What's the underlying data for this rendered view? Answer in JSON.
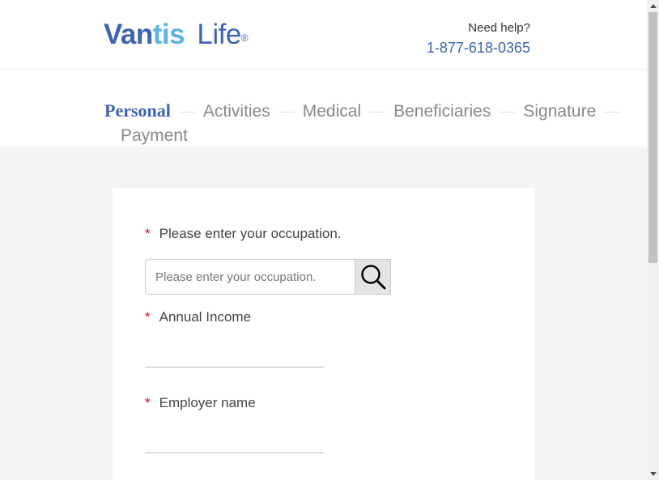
{
  "colors": {
    "brand_blue": "#3d63b4",
    "brand_light_blue": "#5ab4e6",
    "required": "#d0021b",
    "inactive_step": "#888888",
    "page_bg": "#f5f5f5"
  },
  "header": {
    "logo": {
      "part1": "Vantis",
      "part2": "Life",
      "reg": "®"
    },
    "help_label": "Need help?",
    "phone": "1-877-618-0365"
  },
  "steps": {
    "active": "Personal",
    "items": [
      "Activities",
      "Medical",
      "Beneficiaries",
      "Signature",
      "Payment"
    ]
  },
  "form": {
    "occupation": {
      "required_mark": "*",
      "label": "Please enter your occupation.",
      "placeholder": "Please enter your occupation.",
      "value": "",
      "search_icon": "search-icon"
    },
    "annual_income": {
      "required_mark": "*",
      "label": "Annual Income",
      "value": ""
    },
    "employer_name": {
      "required_mark": "*",
      "label": "Employer name",
      "value": ""
    }
  },
  "icons": {
    "scroll_up": "chevron-up-icon",
    "scroll_down": "chevron-down-icon"
  }
}
